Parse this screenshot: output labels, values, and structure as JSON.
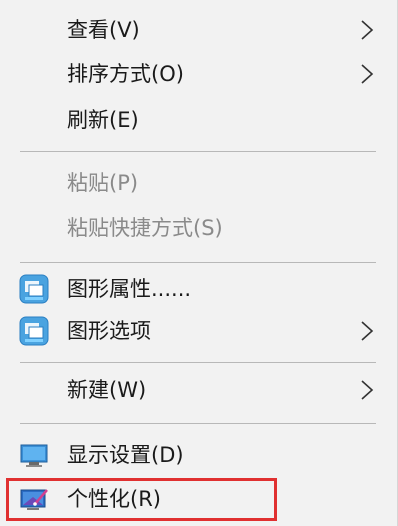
{
  "menu": {
    "items": [
      {
        "label": "查看(V)",
        "has_submenu": true,
        "disabled": false,
        "icon": null
      },
      {
        "label": "排序方式(O)",
        "has_submenu": true,
        "disabled": false,
        "icon": null
      },
      {
        "label": "刷新(E)",
        "has_submenu": false,
        "disabled": false,
        "icon": null
      },
      {
        "label": "粘贴(P)",
        "has_submenu": false,
        "disabled": true,
        "icon": null
      },
      {
        "label": "粘贴快捷方式(S)",
        "has_submenu": false,
        "disabled": true,
        "icon": null
      },
      {
        "label": "图形属性......",
        "has_submenu": false,
        "disabled": false,
        "icon": "intel-graphics-icon"
      },
      {
        "label": "图形选项",
        "has_submenu": true,
        "disabled": false,
        "icon": "intel-graphics-icon"
      },
      {
        "label": "新建(W)",
        "has_submenu": true,
        "disabled": false,
        "icon": null
      },
      {
        "label": "显示设置(D)",
        "has_submenu": false,
        "disabled": false,
        "icon": "display-monitor-icon"
      },
      {
        "label": "个性化(R)",
        "has_submenu": false,
        "disabled": false,
        "icon": "personalize-icon"
      }
    ]
  },
  "colors": {
    "menu_bg": "#f2f2f2",
    "text": "#1a1a1a",
    "disabled_text": "#8a8a8a",
    "separator": "#b8b8b8",
    "highlight_border": "#e03030"
  }
}
